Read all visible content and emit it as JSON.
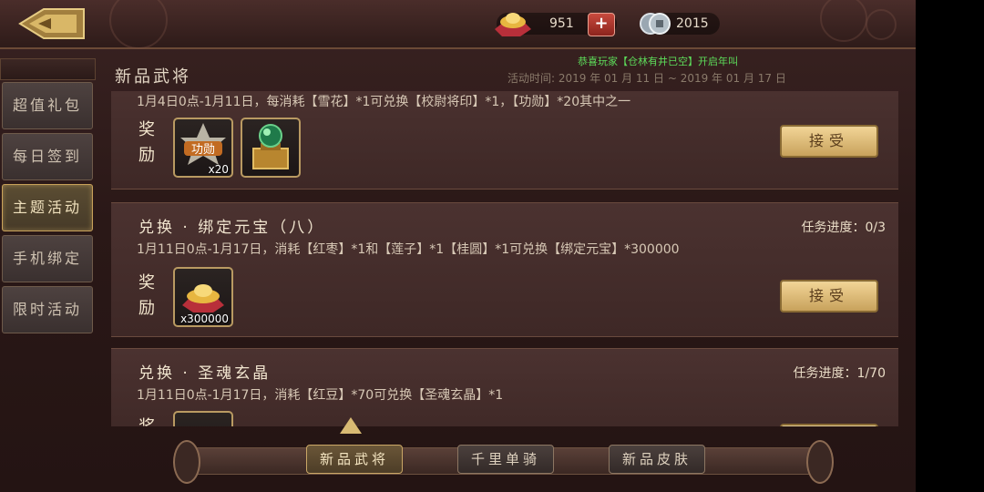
{
  "header": {
    "ingot_amount": "951",
    "coin_amount": "2015"
  },
  "sidebar": {
    "items": [
      {
        "label": "超值礼包",
        "active": false
      },
      {
        "label": "每日签到",
        "active": false
      },
      {
        "label": "主题活动",
        "active": true
      },
      {
        "label": "手机绑定",
        "active": false
      },
      {
        "label": "限时活动",
        "active": false
      }
    ]
  },
  "content": {
    "section_title": "新品武将",
    "ticker_text": "恭喜玩家【仓林有井已空】开启年叫",
    "activity_time": "活动时间: 2019 年 01 月 11 日 ~ 2019 年 01 月 17 日",
    "cards": [
      {
        "desc": "1月4日0点-1月11日，每消耗【雪花】*1可兑换【校尉将印】*1，【功勋】*20其中之一",
        "reward_label": "奖励",
        "rewards": [
          {
            "name": "功勋",
            "qty": "x20"
          },
          {
            "name": "",
            "qty": ""
          }
        ],
        "button": "接受"
      },
      {
        "title": "兑换 · 绑定元宝（八）",
        "progress": "任务进度：0/3",
        "desc": "1月11日0点-1月17日，消耗【红枣】*1和【莲子】*1【桂圆】*1可兑换【绑定元宝】*300000",
        "reward_label": "奖励",
        "rewards": [
          {
            "name": "",
            "qty": "x300000"
          }
        ],
        "button": "接受"
      },
      {
        "title": "兑换 · 圣魂玄晶",
        "progress": "任务进度：1/70",
        "desc": "1月11日0点-1月17日，消耗【红豆】*70可兑换【圣魂玄晶】*1",
        "reward_label": "奖励"
      }
    ]
  },
  "bottom_tabs": [
    {
      "label": "新品武将",
      "active": true
    },
    {
      "label": "千里单骑",
      "active": false
    },
    {
      "label": "新品皮肤",
      "active": false
    }
  ],
  "colors": {
    "accent_gold": "#c9a25a",
    "ticker_green": "#5ddc5a",
    "panel_brown": "#4b3230"
  }
}
